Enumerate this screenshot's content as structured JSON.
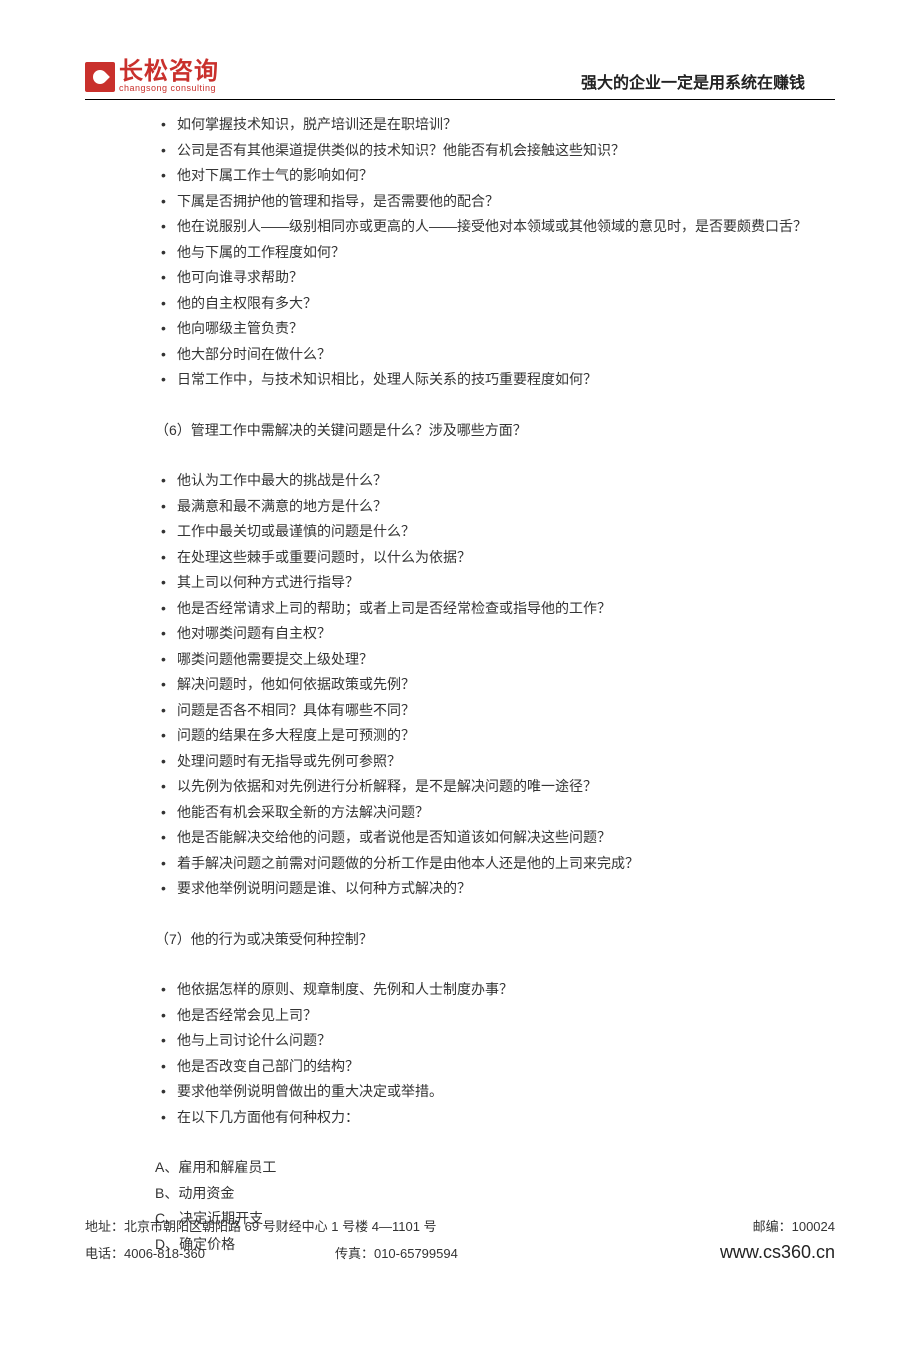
{
  "header": {
    "logo_cn": "长松咨询",
    "logo_en": "changsong consulting",
    "slogan": "强大的企业一定是用系统在赚钱"
  },
  "section5_bullets": [
    "如何掌握技术知识，脱产培训还是在职培训？",
    "公司是否有其他渠道提供类似的技术知识？他能否有机会接触这些知识？",
    "他对下属工作士气的影响如何？",
    "下属是否拥护他的管理和指导，是否需要他的配合？",
    "他在说服别人——级别相同亦或更高的人——接受他对本领域或其他领域的意见时，是否要颇费口舌？",
    "他与下属的工作程度如何？",
    "他可向谁寻求帮助？",
    "他的自主权限有多大？",
    "他向哪级主管负责？",
    "他大部分时间在做什么？",
    "日常工作中，与技术知识相比，处理人际关系的技巧重要程度如何？"
  ],
  "section6_heading": "（6）管理工作中需解决的关键问题是什么？涉及哪些方面？",
  "section6_bullets": [
    "他认为工作中最大的挑战是什么？",
    "最满意和最不满意的地方是什么？",
    "工作中最关切或最谨慎的问题是什么？",
    "在处理这些棘手或重要问题时，以什么为依据？",
    "其上司以何种方式进行指导？",
    "他是否经常请求上司的帮助；或者上司是否经常检查或指导他的工作？",
    "他对哪类问题有自主权？",
    "哪类问题他需要提交上级处理？",
    "解决问题时，他如何依据政策或先例？",
    "问题是否各不相同？具体有哪些不同？",
    "问题的结果在多大程度上是可预测的？",
    "处理问题时有无指导或先例可参照？",
    "以先例为依据和对先例进行分析解释，是不是解决问题的唯一途径？",
    "他能否有机会采取全新的方法解决问题？",
    "他是否能解决交给他的问题，或者说他是否知道该如何解决这些问题？",
    "着手解决问题之前需对问题做的分析工作是由他本人还是他的上司来完成？",
    "要求他举例说明问题是谁、以何种方式解决的？"
  ],
  "section7_heading": "（7）他的行为或决策受何种控制？",
  "section7_bullets": [
    "他依据怎样的原则、规章制度、先例和人士制度办事？",
    "他是否经常会见上司？",
    "他与上司讨论什么问题？",
    "他是否改变自己部门的结构？",
    "要求他举例说明曾做出的重大决定或举措。",
    "在以下几方面他有何种权力："
  ],
  "lettered_items": [
    "A、雇用和解雇员工",
    "B、动用资金",
    "C、决定近期开支",
    "D、确定价格"
  ],
  "footer": {
    "address": "地址：北京市朝阳区朝阳路 69 号财经中心 1 号楼 4—1101 号",
    "postcode": "邮编：100024",
    "phone": "电话：4006-818-360",
    "fax": "传真：010-65799594",
    "website": "www.cs360.cn"
  }
}
